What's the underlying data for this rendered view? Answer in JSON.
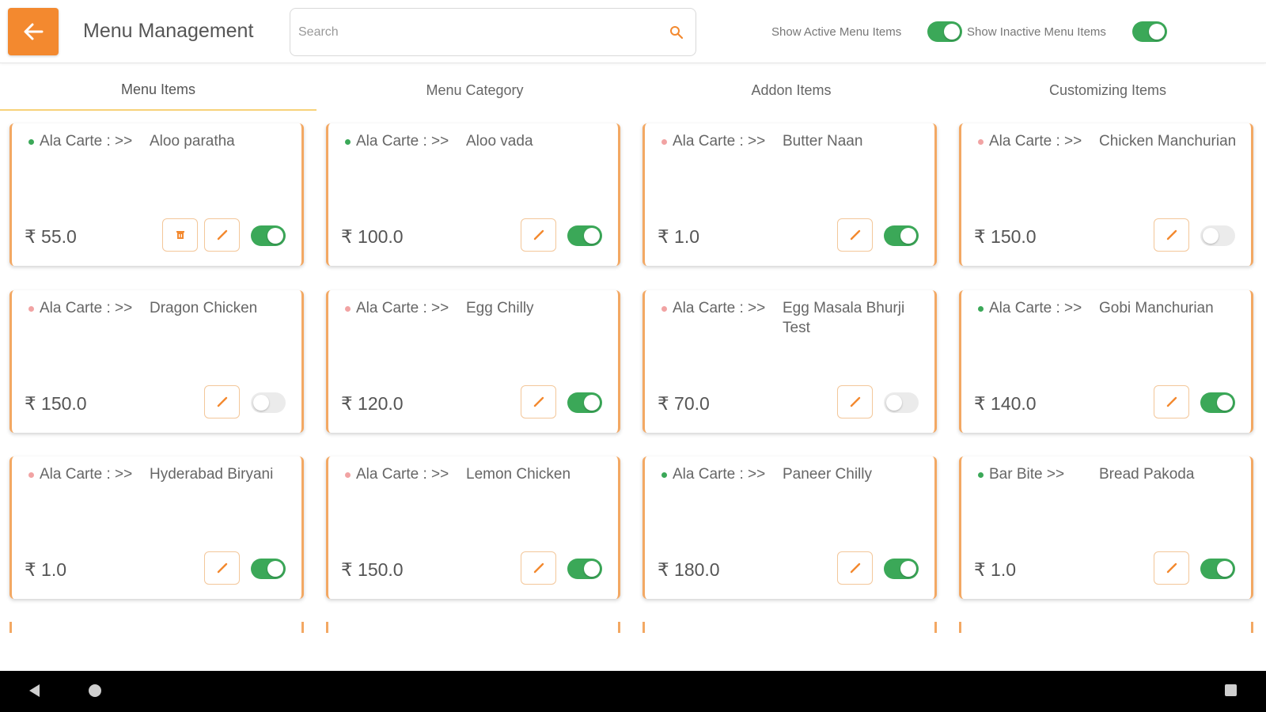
{
  "header": {
    "title": "Menu Management",
    "search_placeholder": "Search",
    "show_active_label": "Show Active Menu Items",
    "show_active_on": true,
    "show_inactive_label": "Show Inactive Menu Items",
    "show_inactive_on": true
  },
  "tabs": [
    {
      "label": "Menu Items",
      "active": true
    },
    {
      "label": "Menu Category",
      "active": false
    },
    {
      "label": "Addon Items",
      "active": false
    },
    {
      "label": "Customizing Items",
      "active": false
    }
  ],
  "items": [
    {
      "category": "Ala Carte : >>",
      "name": "Aloo paratha",
      "price": "₹ 55.0",
      "veg": true,
      "active": true,
      "has_delete": true
    },
    {
      "category": "Ala Carte : >>",
      "name": "Aloo vada",
      "price": "₹ 100.0",
      "veg": true,
      "active": true,
      "has_delete": false
    },
    {
      "category": "Ala Carte : >>",
      "name": "Butter Naan",
      "price": "₹ 1.0",
      "veg": false,
      "active": true,
      "has_delete": false
    },
    {
      "category": "Ala Carte : >>",
      "name": "Chicken Manchurian",
      "price": "₹ 150.0",
      "veg": false,
      "active": false,
      "has_delete": false
    },
    {
      "category": "Ala Carte : >>",
      "name": "Dragon Chicken",
      "price": "₹ 150.0",
      "veg": false,
      "active": false,
      "has_delete": false
    },
    {
      "category": "Ala Carte : >>",
      "name": "Egg Chilly",
      "price": "₹ 120.0",
      "veg": false,
      "active": true,
      "has_delete": false
    },
    {
      "category": "Ala Carte : >>",
      "name": "Egg Masala Bhurji Test",
      "price": "₹ 70.0",
      "veg": false,
      "active": false,
      "has_delete": false
    },
    {
      "category": "Ala Carte : >>",
      "name": "Gobi Manchurian",
      "price": "₹ 140.0",
      "veg": true,
      "active": true,
      "has_delete": false
    },
    {
      "category": "Ala Carte : >>",
      "name": "Hyderabad Biryani",
      "price": "₹ 1.0",
      "veg": false,
      "active": true,
      "has_delete": false
    },
    {
      "category": "Ala Carte : >>",
      "name": "Lemon Chicken",
      "price": "₹ 150.0",
      "veg": false,
      "active": true,
      "has_delete": false
    },
    {
      "category": "Ala Carte : >>",
      "name": "Paneer Chilly",
      "price": "₹ 180.0",
      "veg": true,
      "active": true,
      "has_delete": false
    },
    {
      "category": "Bar Bite >>",
      "name": "Bread Pakoda",
      "price": "₹ 1.0",
      "veg": true,
      "active": true,
      "has_delete": false
    }
  ],
  "colors": {
    "accent": "#f3892f",
    "card_border": "#f3a863",
    "switch_on": "#3ba858",
    "switch_off": "#ebebeb",
    "veg_dot": "#3ba858",
    "nonveg_dot": "#f1a3a3"
  },
  "icons": {
    "back": "arrow-left-icon",
    "search": "search-icon",
    "edit": "pencil-icon",
    "delete": "trash-icon"
  }
}
